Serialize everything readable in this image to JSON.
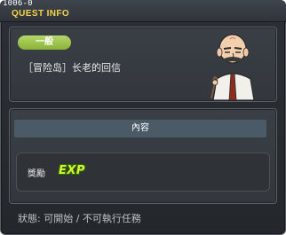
{
  "window": {
    "id_label": "1006-0",
    "title": "QUEST INFO"
  },
  "quest": {
    "category": "一般",
    "name": "［冒险岛］长老的回信"
  },
  "content": {
    "section_label": "內容",
    "reward_label": "獎勵",
    "reward_item": "EXP"
  },
  "status": {
    "text": "狀態: 可開始 / 不可執行任務"
  },
  "colors": {
    "title": "#f5d34a",
    "category_badge": "#9cc34a",
    "exp": "#d7f23a"
  },
  "icons": {
    "npc": "elder-npc-portrait"
  }
}
